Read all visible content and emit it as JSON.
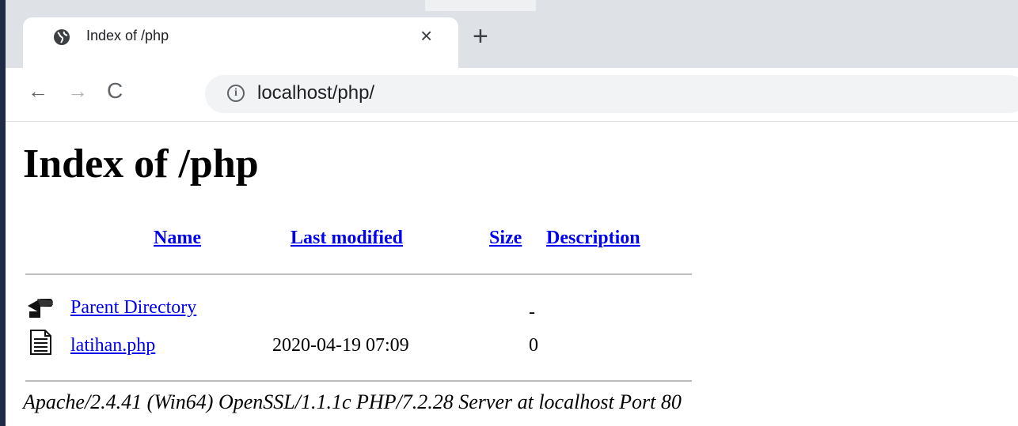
{
  "browser": {
    "tab": {
      "title": "Index of /php",
      "close": "×"
    },
    "new_tab": "+",
    "nav": {
      "back": "←",
      "forward": "→",
      "reload": "C"
    },
    "address": {
      "info": "i",
      "url": "localhost/php/"
    }
  },
  "page": {
    "heading": "Index of /php",
    "columns": {
      "name": "Name",
      "last_modified": "Last modified",
      "size": "Size",
      "description": "Description"
    },
    "rows": [
      {
        "icon": "back-arrow-icon",
        "name": "Parent Directory",
        "modified": "",
        "size": "-",
        "description": ""
      },
      {
        "icon": "text-file-icon",
        "name": "latihan.php",
        "modified": "2020-04-19 07:09",
        "size": "0",
        "description": ""
      }
    ],
    "footer": "Apache/2.4.41 (Win64) OpenSSL/1.1.1c PHP/7.2.28 Server at localhost Port 80"
  }
}
